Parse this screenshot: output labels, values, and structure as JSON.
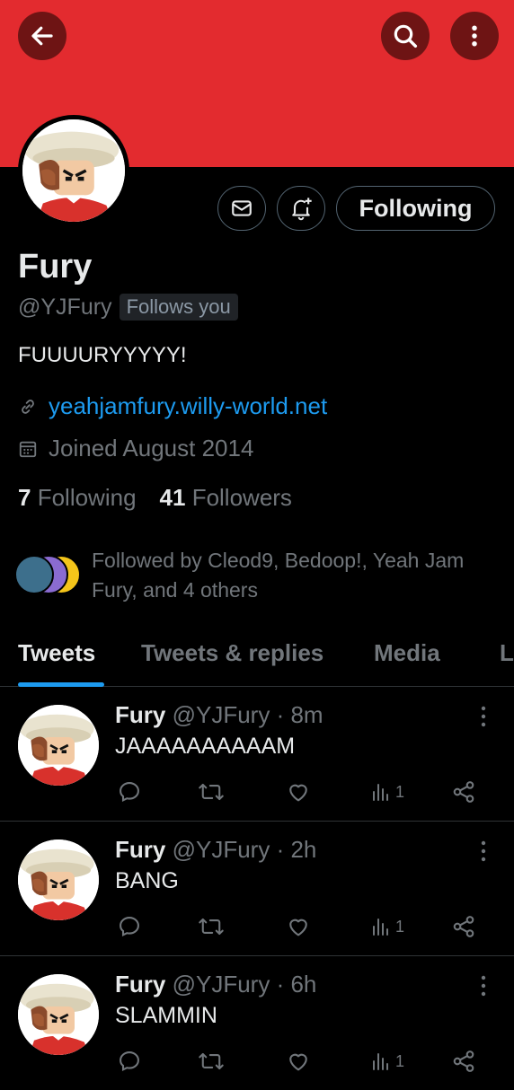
{
  "header": {
    "back_icon": "arrow-left-icon",
    "search_icon": "search-icon",
    "more_icon": "more-vertical-icon",
    "banner_color": "#e32b2f"
  },
  "profile": {
    "name": "Fury",
    "handle": "@YJFury",
    "follows_you": "Follows you",
    "bio": "FUUUURYYYYY!",
    "link": "yeahjamfury.willy-world.net",
    "joined": "Joined August 2014",
    "following_count": "7",
    "following_label": "Following",
    "followers_count": "41",
    "followers_label": "Followers",
    "followed_by": "Followed by Cleod9, Bedoop!, Yeah Jam Fury, and 4 others"
  },
  "actions": {
    "message_icon": "mail-icon",
    "notify_icon": "bell-plus-icon",
    "following_button": "Following"
  },
  "tabs": [
    {
      "label": "Tweets",
      "active": true
    },
    {
      "label": "Tweets & replies",
      "active": false
    },
    {
      "label": "Media",
      "active": false
    },
    {
      "label": "L",
      "active": false
    }
  ],
  "tweets": [
    {
      "name": "Fury",
      "handle": "@YJFury",
      "time": "· 8m",
      "text": "JAAAAAAAAAAM",
      "views": "1"
    },
    {
      "name": "Fury",
      "handle": "@YJFury",
      "time": "· 2h",
      "text": "BANG",
      "views": "1"
    },
    {
      "name": "Fury",
      "handle": "@YJFury",
      "time": "· 6h",
      "text": "SLAMMIN",
      "views": "1"
    }
  ],
  "colors": {
    "accent": "#1d9bf0",
    "muted": "#71767b",
    "background": "#000000"
  }
}
